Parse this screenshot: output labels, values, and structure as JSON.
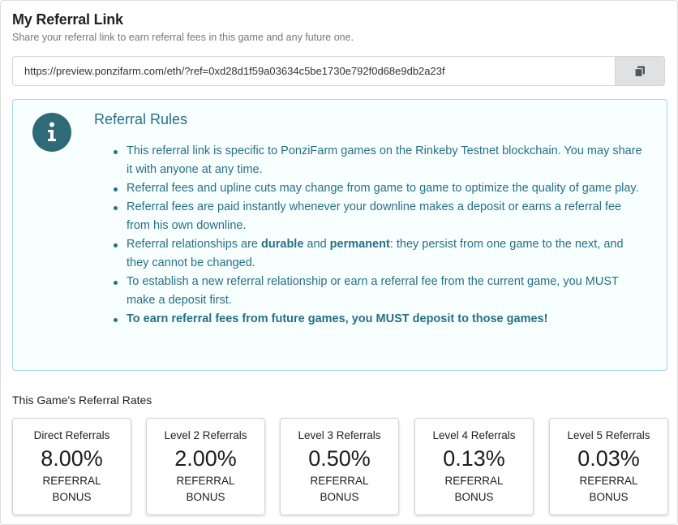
{
  "header": {
    "title": "My Referral Link",
    "subtitle": "Share your referral link to earn referral fees in this game and any future one."
  },
  "referral_link": {
    "value": "https://preview.ponzifarm.com/eth/?ref=0xd28d1f59a03634c5be1730e792f0d68e9db2a23f",
    "copy_icon": "copy-icon"
  },
  "rules": {
    "icon": "info-icon",
    "title": "Referral Rules",
    "items": [
      {
        "text": "This referral link is specific to PonziFarm games on the Rinkeby Testnet blockchain. You may share it with anyone at any time."
      },
      {
        "text": "Referral fees and upline cuts may change from game to game to optimize the quality of game play."
      },
      {
        "text": "Referral fees are paid instantly whenever your downline makes a deposit or earns a referral fee from his own downline."
      },
      {
        "pre": "Referral relationships are ",
        "bold1": "durable",
        "mid": " and ",
        "bold2": "permanent",
        "post": ": they persist from one game to the next, and they cannot be changed."
      },
      {
        "text": "To establish a new referral relationship or earn a referral fee from the current game, you MUST make a deposit first."
      },
      {
        "bold": "To earn referral fees from future games, you MUST deposit to those games!"
      }
    ]
  },
  "rates": {
    "heading": "This Game's Referral Rates",
    "cards": [
      {
        "label": "Direct Referrals",
        "value": "8.00%",
        "unit": "REFERRAL BONUS"
      },
      {
        "label": "Level 2 Referrals",
        "value": "2.00%",
        "unit": "REFERRAL BONUS"
      },
      {
        "label": "Level 3 Referrals",
        "value": "0.50%",
        "unit": "REFERRAL BONUS"
      },
      {
        "label": "Level 4 Referrals",
        "value": "0.13%",
        "unit": "REFERRAL BONUS"
      },
      {
        "label": "Level 5 Referrals",
        "value": "0.03%",
        "unit": "REFERRAL BONUS"
      }
    ]
  },
  "colors": {
    "info_accent": "#276f86",
    "info_background": "#f8ffff",
    "info_border": "#a9d5de",
    "button_background": "#e0e1e2"
  }
}
